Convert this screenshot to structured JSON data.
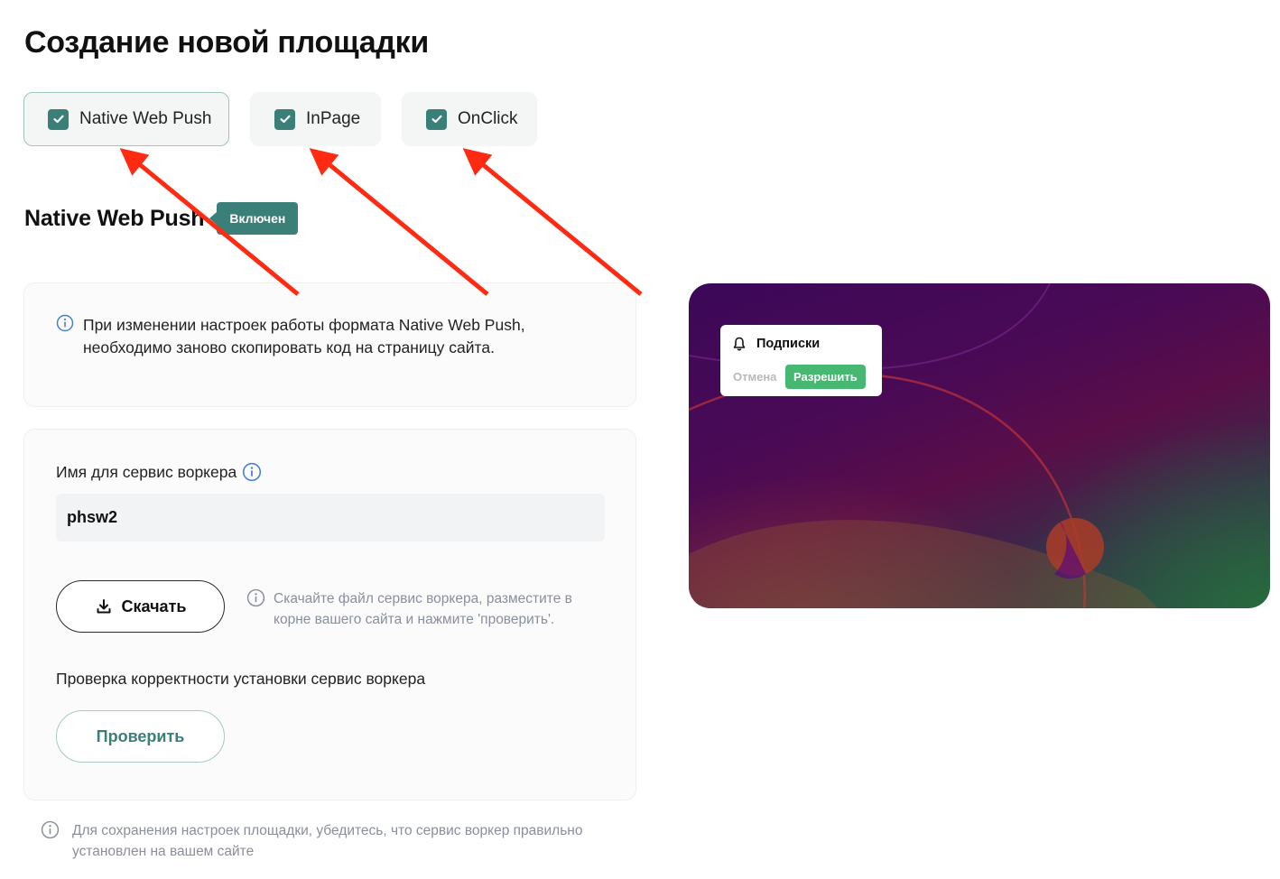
{
  "page": {
    "title": "Создание новой площадки"
  },
  "format_tabs": [
    {
      "label": "Native Web Push",
      "checked": true,
      "active": true
    },
    {
      "label": "InPage",
      "checked": true,
      "active": false
    },
    {
      "label": "OnClick",
      "checked": true,
      "active": false
    }
  ],
  "section": {
    "title": "Native Web Push",
    "status_badge": "Включен"
  },
  "notice": {
    "icon": "info-icon",
    "text": "При изменении настроек работы формата Native Web Push, необходимо заново скопировать код на страницу сайта."
  },
  "service_worker": {
    "name_label": "Имя для сервис воркера",
    "name_value": "phsw2",
    "download_button": "Скачать",
    "download_hint": "Скачайте файл сервис воркера, разместите в корне вашего сайта и нажмите 'проверить'.",
    "check_label": "Проверка корректности установки сервис воркера",
    "check_button": "Проверить"
  },
  "footer_note": "Для сохранения настроек площадки, убедитесь, что сервис воркер правильно установлен на вашем сайте",
  "preview": {
    "popup_title": "Подписки",
    "popup_icon": "bell-icon",
    "cancel_label": "Отмена",
    "allow_label": "Разрешить"
  },
  "colors": {
    "accent": "#3a7f78",
    "allow_green": "#47b872",
    "info_blue": "#4a7fd6",
    "hint_gray": "#8a8f9c",
    "annotation_red": "#ff2a12"
  }
}
